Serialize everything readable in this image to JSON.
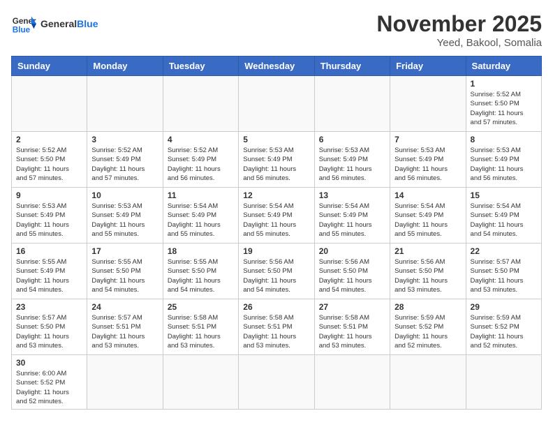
{
  "header": {
    "logo_general": "General",
    "logo_blue": "Blue",
    "month_year": "November 2025",
    "location": "Yeed, Bakool, Somalia"
  },
  "weekdays": [
    "Sunday",
    "Monday",
    "Tuesday",
    "Wednesday",
    "Thursday",
    "Friday",
    "Saturday"
  ],
  "weeks": [
    [
      {
        "day": "",
        "text": ""
      },
      {
        "day": "",
        "text": ""
      },
      {
        "day": "",
        "text": ""
      },
      {
        "day": "",
        "text": ""
      },
      {
        "day": "",
        "text": ""
      },
      {
        "day": "",
        "text": ""
      },
      {
        "day": "1",
        "text": "Sunrise: 5:52 AM\nSunset: 5:50 PM\nDaylight: 11 hours\nand 57 minutes."
      }
    ],
    [
      {
        "day": "2",
        "text": "Sunrise: 5:52 AM\nSunset: 5:50 PM\nDaylight: 11 hours\nand 57 minutes."
      },
      {
        "day": "3",
        "text": "Sunrise: 5:52 AM\nSunset: 5:49 PM\nDaylight: 11 hours\nand 57 minutes."
      },
      {
        "day": "4",
        "text": "Sunrise: 5:52 AM\nSunset: 5:49 PM\nDaylight: 11 hours\nand 56 minutes."
      },
      {
        "day": "5",
        "text": "Sunrise: 5:53 AM\nSunset: 5:49 PM\nDaylight: 11 hours\nand 56 minutes."
      },
      {
        "day": "6",
        "text": "Sunrise: 5:53 AM\nSunset: 5:49 PM\nDaylight: 11 hours\nand 56 minutes."
      },
      {
        "day": "7",
        "text": "Sunrise: 5:53 AM\nSunset: 5:49 PM\nDaylight: 11 hours\nand 56 minutes."
      },
      {
        "day": "8",
        "text": "Sunrise: 5:53 AM\nSunset: 5:49 PM\nDaylight: 11 hours\nand 56 minutes."
      }
    ],
    [
      {
        "day": "9",
        "text": "Sunrise: 5:53 AM\nSunset: 5:49 PM\nDaylight: 11 hours\nand 55 minutes."
      },
      {
        "day": "10",
        "text": "Sunrise: 5:53 AM\nSunset: 5:49 PM\nDaylight: 11 hours\nand 55 minutes."
      },
      {
        "day": "11",
        "text": "Sunrise: 5:54 AM\nSunset: 5:49 PM\nDaylight: 11 hours\nand 55 minutes."
      },
      {
        "day": "12",
        "text": "Sunrise: 5:54 AM\nSunset: 5:49 PM\nDaylight: 11 hours\nand 55 minutes."
      },
      {
        "day": "13",
        "text": "Sunrise: 5:54 AM\nSunset: 5:49 PM\nDaylight: 11 hours\nand 55 minutes."
      },
      {
        "day": "14",
        "text": "Sunrise: 5:54 AM\nSunset: 5:49 PM\nDaylight: 11 hours\nand 55 minutes."
      },
      {
        "day": "15",
        "text": "Sunrise: 5:54 AM\nSunset: 5:49 PM\nDaylight: 11 hours\nand 54 minutes."
      }
    ],
    [
      {
        "day": "16",
        "text": "Sunrise: 5:55 AM\nSunset: 5:49 PM\nDaylight: 11 hours\nand 54 minutes."
      },
      {
        "day": "17",
        "text": "Sunrise: 5:55 AM\nSunset: 5:50 PM\nDaylight: 11 hours\nand 54 minutes."
      },
      {
        "day": "18",
        "text": "Sunrise: 5:55 AM\nSunset: 5:50 PM\nDaylight: 11 hours\nand 54 minutes."
      },
      {
        "day": "19",
        "text": "Sunrise: 5:56 AM\nSunset: 5:50 PM\nDaylight: 11 hours\nand 54 minutes."
      },
      {
        "day": "20",
        "text": "Sunrise: 5:56 AM\nSunset: 5:50 PM\nDaylight: 11 hours\nand 54 minutes."
      },
      {
        "day": "21",
        "text": "Sunrise: 5:56 AM\nSunset: 5:50 PM\nDaylight: 11 hours\nand 53 minutes."
      },
      {
        "day": "22",
        "text": "Sunrise: 5:57 AM\nSunset: 5:50 PM\nDaylight: 11 hours\nand 53 minutes."
      }
    ],
    [
      {
        "day": "23",
        "text": "Sunrise: 5:57 AM\nSunset: 5:50 PM\nDaylight: 11 hours\nand 53 minutes."
      },
      {
        "day": "24",
        "text": "Sunrise: 5:57 AM\nSunset: 5:51 PM\nDaylight: 11 hours\nand 53 minutes."
      },
      {
        "day": "25",
        "text": "Sunrise: 5:58 AM\nSunset: 5:51 PM\nDaylight: 11 hours\nand 53 minutes."
      },
      {
        "day": "26",
        "text": "Sunrise: 5:58 AM\nSunset: 5:51 PM\nDaylight: 11 hours\nand 53 minutes."
      },
      {
        "day": "27",
        "text": "Sunrise: 5:58 AM\nSunset: 5:51 PM\nDaylight: 11 hours\nand 53 minutes."
      },
      {
        "day": "28",
        "text": "Sunrise: 5:59 AM\nSunset: 5:52 PM\nDaylight: 11 hours\nand 52 minutes."
      },
      {
        "day": "29",
        "text": "Sunrise: 5:59 AM\nSunset: 5:52 PM\nDaylight: 11 hours\nand 52 minutes."
      }
    ],
    [
      {
        "day": "30",
        "text": "Sunrise: 6:00 AM\nSunset: 5:52 PM\nDaylight: 11 hours\nand 52 minutes."
      },
      {
        "day": "",
        "text": ""
      },
      {
        "day": "",
        "text": ""
      },
      {
        "day": "",
        "text": ""
      },
      {
        "day": "",
        "text": ""
      },
      {
        "day": "",
        "text": ""
      },
      {
        "day": "",
        "text": ""
      }
    ]
  ]
}
